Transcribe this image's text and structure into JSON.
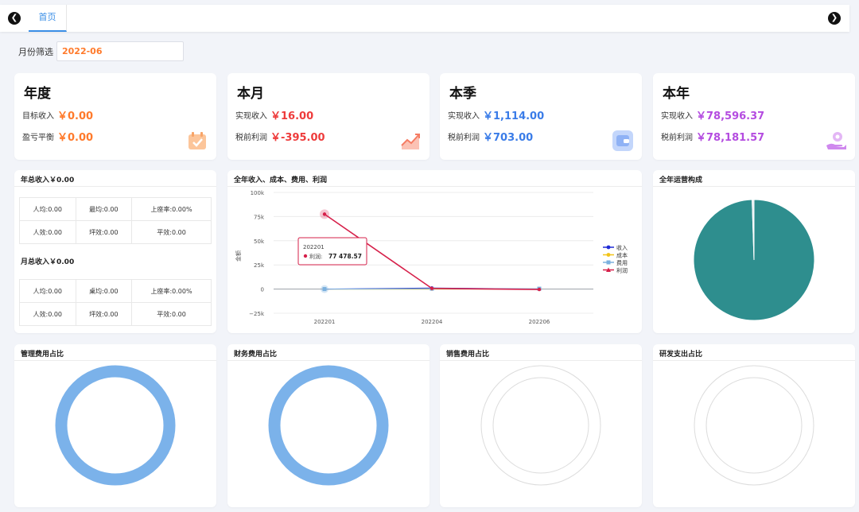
{
  "tabs": {
    "home_label": "首页"
  },
  "filter": {
    "label": "月份筛选",
    "value": "2022-06"
  },
  "colors": {
    "orange": "#ff7a2b",
    "red": "#ee3b3b",
    "blue": "#3a7ce8",
    "purple": "#b44ce0",
    "teal": "#2e8e8e",
    "donut_blue": "#7bb2ea"
  },
  "stat_cards": [
    {
      "title": "年度",
      "rows": [
        {
          "label": "目标收入",
          "value": "￥0.00"
        },
        {
          "label": "盈亏平衡",
          "value": "￥0.00"
        }
      ],
      "icon": "calendar-check-icon"
    },
    {
      "title": "本月",
      "rows": [
        {
          "label": "实现收入",
          "value": "￥16.00"
        },
        {
          "label": "税前利润",
          "value": "￥-395.00"
        }
      ],
      "icon": "trend-chart-icon"
    },
    {
      "title": "本季",
      "rows": [
        {
          "label": "实现收入",
          "value": "￥1,114.00"
        },
        {
          "label": "税前利润",
          "value": "￥703.00"
        }
      ],
      "icon": "wallet-icon"
    },
    {
      "title": "本年",
      "rows": [
        {
          "label": "实现收入",
          "value": "￥78,596.37"
        },
        {
          "label": "税前利润",
          "value": "￥78,181.57"
        }
      ],
      "icon": "hand-coin-icon"
    }
  ],
  "annual_panel": {
    "title": "年总收入￥0.00",
    "year_table": [
      [
        "人均:0.00",
        "最均:0.00",
        "上座率:0.00%"
      ],
      [
        "人效:0.00",
        "坪效:0.00",
        "平效:0.00"
      ]
    ],
    "month_title": "月总收入￥0.00",
    "month_table": [
      [
        "人均:0.00",
        "桌均:0.00",
        "上座率:0.00%"
      ],
      [
        "人效:0.00",
        "坪效:0.00",
        "平效:0.00"
      ]
    ]
  },
  "line_panel": {
    "title": "全年收入、成本、费用、利润"
  },
  "pie_panel": {
    "title": "全年运营构成"
  },
  "donut_panels": [
    {
      "title": "管理费用占比"
    },
    {
      "title": "财务费用占比"
    },
    {
      "title": "销售费用占比"
    },
    {
      "title": "研发支出占比"
    }
  ],
  "chart_data": [
    {
      "type": "line",
      "title": "全年收入、成本、费用、利润",
      "ylabel": "金额",
      "x": [
        "202201",
        "202204",
        "202206"
      ],
      "ylim": [
        -25000,
        100000
      ],
      "yticks": [
        "100k",
        "75k",
        "50k",
        "25k",
        "0",
        "−25k"
      ],
      "yticks_values": [
        100000,
        75000,
        50000,
        25000,
        0,
        -25000
      ],
      "legend_position": "right",
      "series": [
        {
          "name": "收入",
          "color": "#1f2bd6",
          "values": [
            0,
            1114,
            16
          ]
        },
        {
          "name": "成本",
          "color": "#f2c418",
          "values": [
            0,
            0,
            0
          ]
        },
        {
          "name": "费用",
          "color": "#7bb0de",
          "values": [
            0,
            411,
            411
          ]
        },
        {
          "name": "利润",
          "color": "#d6204a",
          "values": [
            77478.57,
            703,
            -395
          ]
        }
      ],
      "tooltip": {
        "x": "202201",
        "label": "利润",
        "value": "77 478.57"
      }
    },
    {
      "type": "pie",
      "title": "全年运营构成",
      "values": [
        99.5,
        0.5
      ],
      "colors": [
        "#2e8e8e",
        "#dfe9ef"
      ]
    },
    {
      "type": "pie",
      "title": "管理费用占比",
      "values": [
        100
      ],
      "colors": [
        "#7bb2ea"
      ]
    },
    {
      "type": "pie",
      "title": "财务费用占比",
      "values": [
        100
      ],
      "colors": [
        "#7bb2ea"
      ]
    },
    {
      "type": "pie",
      "title": "销售费用占比",
      "values": [],
      "colors": []
    },
    {
      "type": "pie",
      "title": "研发支出占比",
      "values": [],
      "colors": []
    }
  ]
}
